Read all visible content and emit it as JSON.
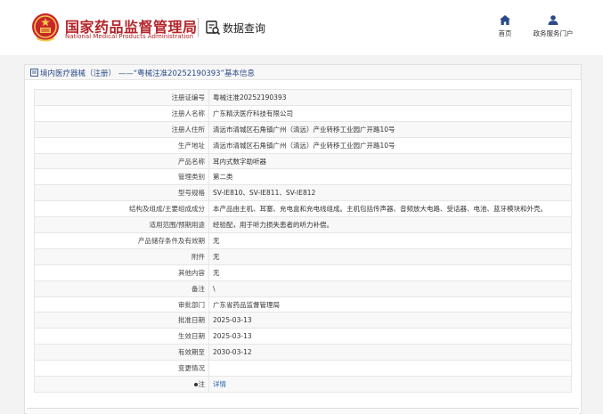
{
  "header": {
    "org_name_cn": "国家药品监督管理局",
    "org_name_en": "National Medical Products Administration",
    "query_title": "数据查询",
    "nav": [
      {
        "label": "首页",
        "icon": "home-icon"
      },
      {
        "label": "政务服务门户",
        "icon": "user-icon"
      }
    ]
  },
  "breadcrumb": "境内医疗器械（注册） ——“粤械注准20252190393”基本信息",
  "fields": [
    {
      "label": "注册证编号",
      "value": "粤械注准20252190393"
    },
    {
      "label": "注册人名称",
      "value": "广东精沃医疗科技有限公司"
    },
    {
      "label": "注册人住所",
      "value": "清远市清城区石角镇广州（清远）产业转移工业园广开路10号"
    },
    {
      "label": "生产地址",
      "value": "清远市清城区石角镇广州（清远）产业转移工业园广开路10号"
    },
    {
      "label": "产品名称",
      "value": "耳内式数字助听器"
    },
    {
      "label": "管理类别",
      "value": "第二类"
    },
    {
      "label": "型号规格",
      "value": "SV-IE810、SV-IE811、SV-IE812"
    },
    {
      "label": "结构及组成/主要组成成分",
      "value": "本产品由主机、耳塞、充电盒和充电线组成。主机包括传声器、音频放大电路、受话器、电池、蓝牙模块和外壳。"
    },
    {
      "label": "适用范围/预期用途",
      "value": "经验配，用于听力损失患者的听力补偿。"
    },
    {
      "label": "产品储存条件及有效期",
      "value": "无"
    },
    {
      "label": "附件",
      "value": "无"
    },
    {
      "label": "其他内容",
      "value": "无"
    },
    {
      "label": "备注",
      "value": "\\"
    },
    {
      "label": "审批部门",
      "value": "广东省药品监督管理局"
    },
    {
      "label": "批准日期",
      "value": "2025-03-13"
    },
    {
      "label": "生效日期",
      "value": "2025-03-13"
    },
    {
      "label": "有效期至",
      "value": "2030-03-12"
    },
    {
      "label": "变更情况",
      "value": ""
    },
    {
      "label": "注",
      "value": "详情"
    }
  ],
  "colors": {
    "brand_red": "#b3252a",
    "link_blue": "#2a5fb0",
    "crumb_blue": "#2a4a8a"
  }
}
